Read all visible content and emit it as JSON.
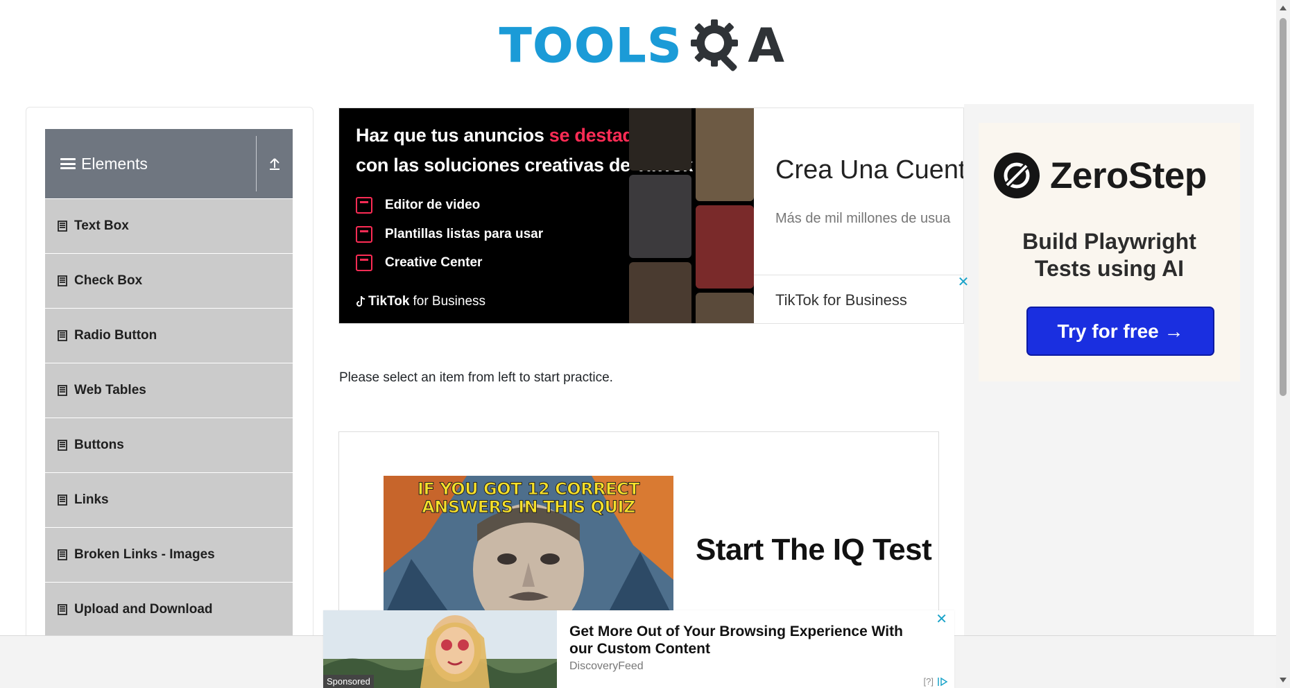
{
  "header": {
    "logo_text_left": "TOOLS",
    "logo_text_right": "A"
  },
  "sidebar": {
    "group_title": "Elements",
    "items": [
      {
        "label": "Text Box"
      },
      {
        "label": "Check Box"
      },
      {
        "label": "Radio Button"
      },
      {
        "label": "Web Tables"
      },
      {
        "label": "Buttons"
      },
      {
        "label": "Links"
      },
      {
        "label": "Broken Links - Images"
      },
      {
        "label": "Upload and Download"
      }
    ]
  },
  "main": {
    "instruction": "Please select an item from left to start practice."
  },
  "ads": {
    "tiktok": {
      "headline_part1": "Haz que tus anuncios ",
      "headline_highlight": "se destaquen",
      "headline_part2": "con las soluciones creativas de TikTok",
      "features": [
        "Editor de video",
        "Plantillas listas para usar",
        "Creative Center"
      ],
      "brand_bold": "TikTok",
      "brand_rest": "for Business",
      "right_title": "Crea Una Cuenta",
      "right_subtitle": "Más de mil millones de usua",
      "right_brand": "TikTok for Business",
      "accent_color": "#fe2c55"
    },
    "iq": {
      "image_caption_line1": "IF YOU GOT 12 CORRECT",
      "image_caption_line2": "ANSWERS IN THIS QUIZ",
      "title": "Start The IQ Test"
    },
    "zerostep": {
      "name": "ZeroStep",
      "tagline_line1": "Build Playwright",
      "tagline_line2": "Tests using AI",
      "cta": "Try for free →",
      "cta_color": "#1a2fe0"
    },
    "bottom": {
      "title": "Get More Out of Your Browsing Experience With our Custom Content",
      "source": "DiscoveryFeed",
      "sponsored": "Sponsored",
      "adchoice": "[?]"
    }
  },
  "icons": {
    "menu": "hamburger-icon",
    "collapse": "collapse-up-icon",
    "item": "document-icon",
    "close": "close-icon"
  },
  "colors": {
    "logo_blue": "#1b9bd7",
    "sidebar_header": "#6f7680",
    "sidebar_item": "#cbcbcb",
    "close_accent": "#1aa3c9"
  }
}
